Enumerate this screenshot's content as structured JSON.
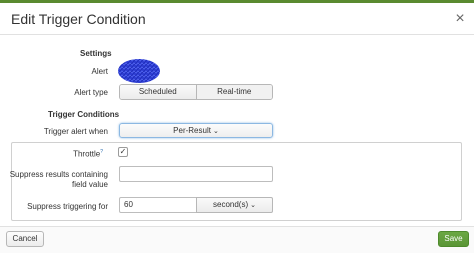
{
  "dialog": {
    "title": "Edit Trigger Condition"
  },
  "settings": {
    "heading": "Settings",
    "alert_label": "Alert",
    "alert_type_label": "Alert type",
    "alert_type_options": [
      "Scheduled",
      "Real-time"
    ],
    "alert_type_selected": "Real-time"
  },
  "trigger": {
    "heading": "Trigger Conditions",
    "when_label": "Trigger alert when",
    "when_value": "Per-Result"
  },
  "throttle": {
    "label": "Throttle",
    "help_mark": "?",
    "checked": true,
    "suppress_fields_label_line1": "Suppress results containing",
    "suppress_fields_label_line2": "field value",
    "suppress_fields_value": "",
    "suppress_for_label": "Suppress triggering for",
    "suppress_for_value": "60",
    "suppress_for_unit": "second(s)"
  },
  "footer": {
    "cancel_label": "Cancel",
    "save_label": "Save"
  },
  "colors": {
    "accent_green": "#5a9536",
    "focus_blue": "#8cb8e2",
    "redacted_blue": "#2d3fd6"
  },
  "icons": {
    "close": "close-icon",
    "chevron": "chevron-down-icon",
    "check": "checkmark-icon"
  }
}
